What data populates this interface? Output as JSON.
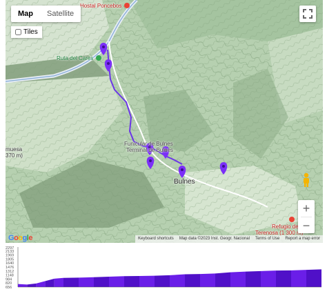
{
  "map_type": {
    "map": "Map",
    "satellite": "Satellite",
    "selected": "Map"
  },
  "tiles_label": "Tiles",
  "labels": {
    "hostal": "Hostal Poncebos",
    "ruta": "Ruta del Cares",
    "funicular": "Funicular de Bulnes",
    "funicular2": "Terminal de Bulnes",
    "bulnes": "Bulnes",
    "refugio": "Refugio de",
    "refugio2": "Terenosa (1 300 m)",
    "muesa": "muesa",
    "muesa_elev": "370 m)"
  },
  "attribution": {
    "shortcuts": "Keyboard shortcuts",
    "data": "Map data ©2023 Inst. Geogr. Nacional",
    "terms": "Terms of Use",
    "report": "Report a map error"
  },
  "google": "Google",
  "icons": [
    "fullscreen-icon",
    "pegman-icon",
    "zoom-in-icon",
    "zoom-out-icon",
    "map-pin-icon"
  ],
  "chart_data": {
    "type": "area",
    "y_ticks": [
      "2297",
      "2133",
      "1969",
      "1805",
      "1640",
      "1476",
      "1312",
      "1148",
      "984",
      "820",
      "656"
    ],
    "ylim": [
      656,
      2297
    ],
    "x": [
      0,
      0.03,
      0.06,
      0.09,
      0.12,
      0.15,
      0.2,
      0.25,
      0.3,
      0.35,
      0.4,
      0.45,
      0.5,
      0.55,
      0.6,
      0.65,
      0.7,
      0.75,
      0.8,
      0.85,
      0.9,
      0.95,
      1.0
    ],
    "values": [
      780,
      760,
      800,
      900,
      1000,
      1030,
      1040,
      1060,
      1080,
      1100,
      1110,
      1120,
      1140,
      1180,
      1190,
      1210,
      1260,
      1290,
      1310,
      1330,
      1340,
      1360,
      1380
    ],
    "colors": {
      "fill": "#6a1ee8",
      "fill_dark": "#5010c8",
      "axis": "#555555"
    }
  },
  "colors": {
    "route": "#6b35e8",
    "pin": "#7b2ff7"
  }
}
